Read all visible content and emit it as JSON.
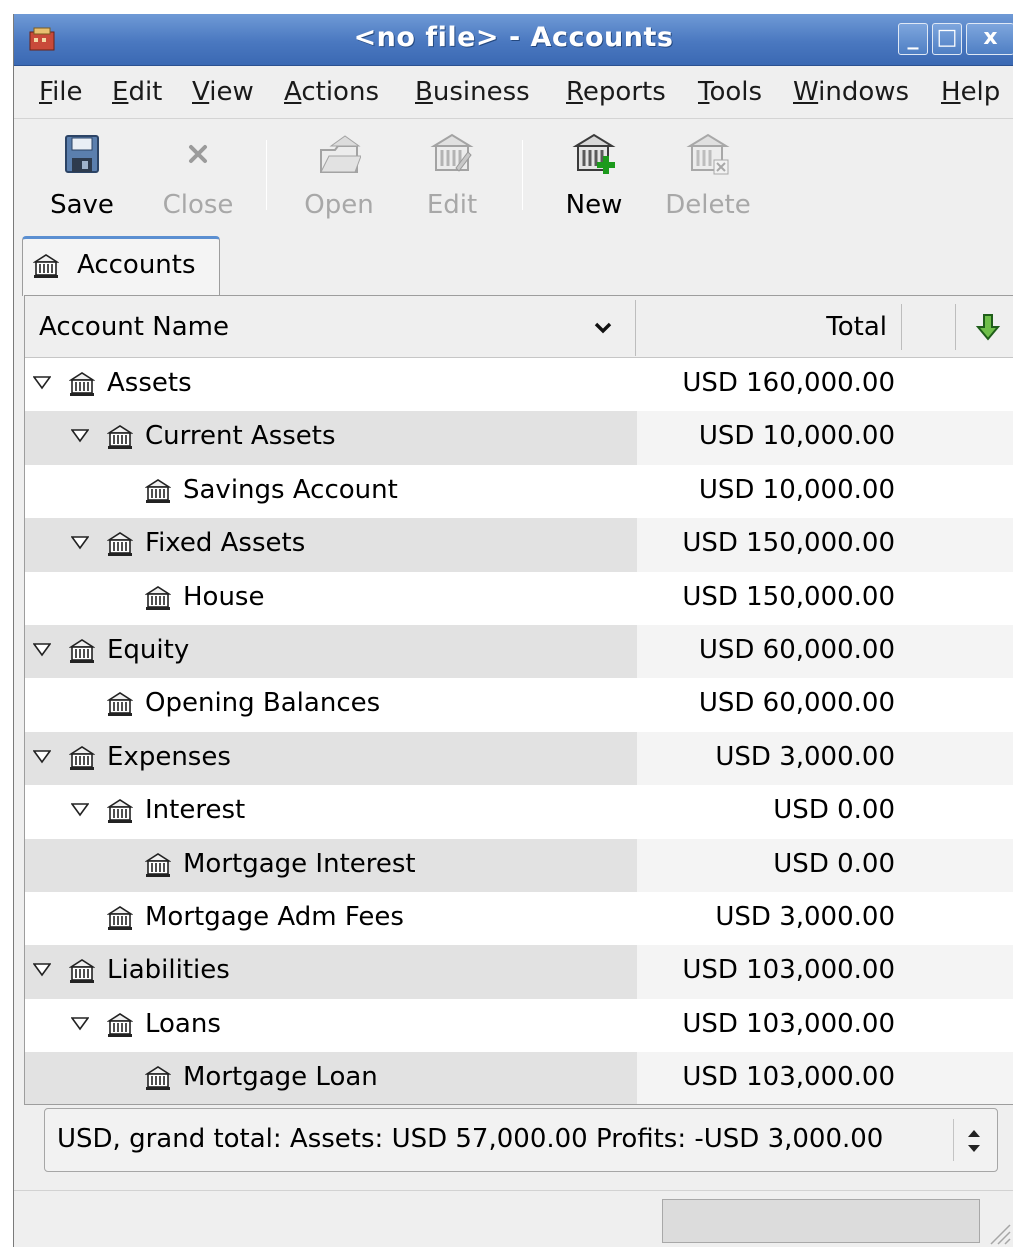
{
  "window": {
    "title": "<no file> - Accounts",
    "controls": {
      "minimize": "_",
      "maximize": "□",
      "close": "x"
    }
  },
  "menu": [
    {
      "accel": "F",
      "rest": "ile"
    },
    {
      "accel": "E",
      "rest": "dit"
    },
    {
      "accel": "V",
      "rest": "iew"
    },
    {
      "accel": "A",
      "rest": "ctions"
    },
    {
      "accel": "B",
      "rest": "usiness"
    },
    {
      "accel": "R",
      "rest": "eports"
    },
    {
      "accel": "T",
      "rest": "ools"
    },
    {
      "accel": "W",
      "rest": "indows"
    },
    {
      "accel": "H",
      "rest": "elp"
    }
  ],
  "toolbar": {
    "save": {
      "label": "Save",
      "enabled": true,
      "icon": "floppy-disk-icon"
    },
    "close": {
      "label": "Close",
      "enabled": false,
      "icon": "close-x-icon"
    },
    "open": {
      "label": "Open",
      "enabled": false,
      "icon": "open-account-icon"
    },
    "edit": {
      "label": "Edit",
      "enabled": false,
      "icon": "edit-account-icon"
    },
    "new": {
      "label": "New",
      "enabled": true,
      "icon": "new-account-icon"
    },
    "delete": {
      "label": "Delete",
      "enabled": false,
      "icon": "delete-account-icon"
    }
  },
  "tabs": [
    {
      "label": "Accounts",
      "icon": "bank-icon",
      "active": true
    }
  ],
  "table": {
    "columns": {
      "name": "Account Name",
      "total": "Total"
    },
    "rows": [
      {
        "name": "Assets",
        "total": "USD 160,000.00",
        "depth": 0,
        "expanded": true
      },
      {
        "name": "Current Assets",
        "total": "USD 10,000.00",
        "depth": 1,
        "expanded": true
      },
      {
        "name": "Savings Account",
        "total": "USD 10,000.00",
        "depth": 2,
        "expanded": null
      },
      {
        "name": "Fixed Assets",
        "total": "USD 150,000.00",
        "depth": 1,
        "expanded": true
      },
      {
        "name": "House",
        "total": "USD 150,000.00",
        "depth": 2,
        "expanded": null
      },
      {
        "name": "Equity",
        "total": "USD 60,000.00",
        "depth": 0,
        "expanded": true
      },
      {
        "name": "Opening Balances",
        "total": "USD 60,000.00",
        "depth": 1,
        "expanded": null
      },
      {
        "name": "Expenses",
        "total": "USD 3,000.00",
        "depth": 0,
        "expanded": true
      },
      {
        "name": "Interest",
        "total": "USD 0.00",
        "depth": 1,
        "expanded": true
      },
      {
        "name": "Mortgage Interest",
        "total": "USD 0.00",
        "depth": 2,
        "expanded": null
      },
      {
        "name": "Mortgage Adm Fees",
        "total": "USD 3,000.00",
        "depth": 1,
        "expanded": null
      },
      {
        "name": "Liabilities",
        "total": "USD 103,000.00",
        "depth": 0,
        "expanded": true
      },
      {
        "name": "Loans",
        "total": "USD 103,000.00",
        "depth": 1,
        "expanded": true
      },
      {
        "name": "Mortgage Loan",
        "total": "USD 103,000.00",
        "depth": 2,
        "expanded": null
      }
    ]
  },
  "summary": {
    "text": "USD, grand total:  Assets: USD 57,000.00  Profits: -USD 3,000.00"
  },
  "colors": {
    "title_bar": "#4a78c0",
    "tab_accent": "#5b8fd1",
    "new_plus": "#1c9a1c",
    "sort_arrow": "#2f8a2f"
  }
}
